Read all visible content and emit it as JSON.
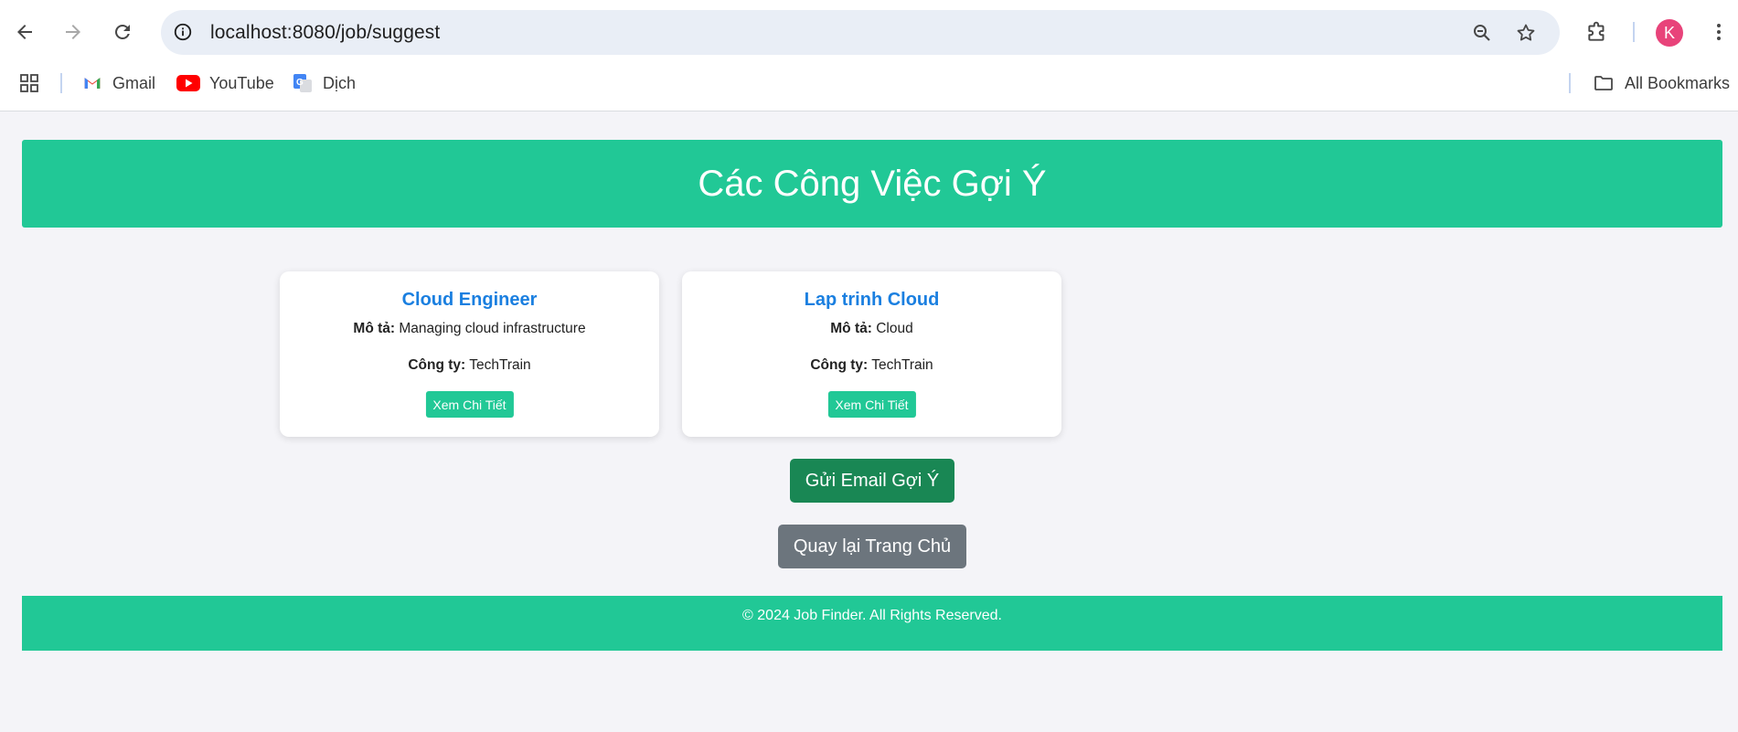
{
  "browser": {
    "url_host": "localhost",
    "url_rest": ":8080/job/suggest",
    "avatar_initial": "K",
    "bookmarks": [
      {
        "label": "Gmail",
        "icon": "gmail-icon"
      },
      {
        "label": "YouTube",
        "icon": "youtube-icon"
      },
      {
        "label": "Dịch",
        "icon": "google-translate-icon"
      }
    ],
    "all_bookmarks_label": "All Bookmarks"
  },
  "page": {
    "title": "Các Công Việc Gợi Ý",
    "jobs": [
      {
        "title": "Cloud Engineer",
        "desc_label": "Mô tả:",
        "desc": " Managing cloud infrastructure",
        "company_label": "Công ty:",
        "company": " TechTrain",
        "detail_button": "Xem Chi Tiết"
      },
      {
        "title": "Lap trinh Cloud",
        "desc_label": "Mô tả:",
        "desc": " Cloud",
        "company_label": "Công ty:",
        "company": " TechTrain",
        "detail_button": "Xem Chi Tiết"
      }
    ],
    "send_email_button": "Gửi Email Gợi Ý",
    "back_home_button": "Quay lại Trang Chủ",
    "footer": "© 2024 Job Finder. All Rights Reserved."
  },
  "colors": {
    "accent": "#21c896",
    "title_link": "#1a7fe0",
    "email_button": "#198754",
    "home_button": "#6c757d",
    "background": "#f4f4f8"
  }
}
